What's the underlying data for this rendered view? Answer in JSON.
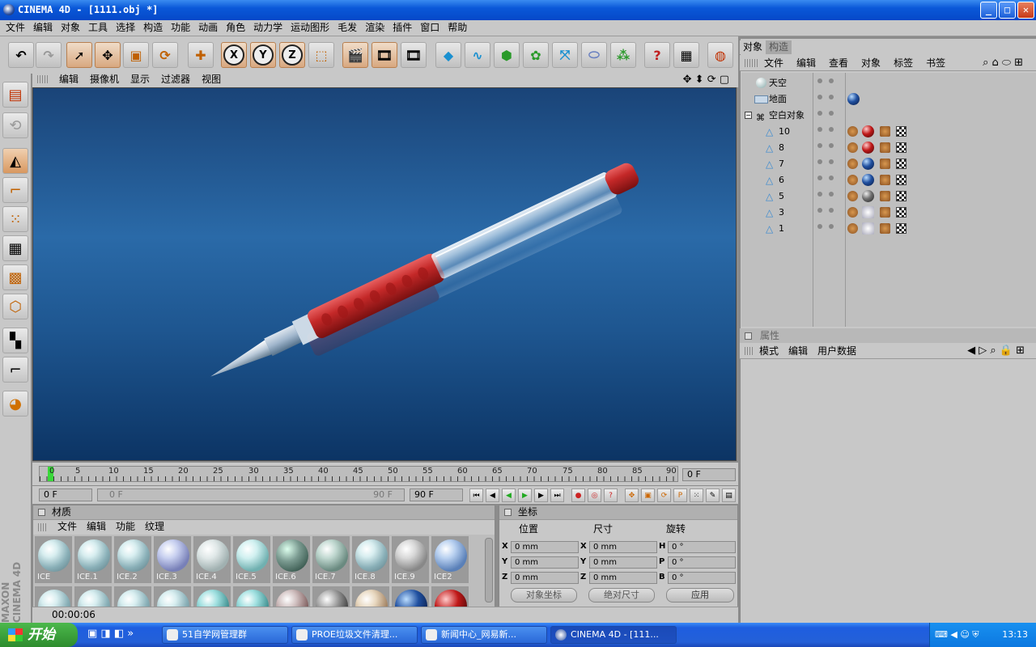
{
  "window": {
    "title": "CINEMA 4D - [1111.obj *]",
    "min": "_",
    "max": "□",
    "close": "✕"
  },
  "menubar": [
    "文件",
    "编辑",
    "对象",
    "工具",
    "选择",
    "构造",
    "功能",
    "动画",
    "角色",
    "动力学",
    "运动图形",
    "毛发",
    "渲染",
    "插件",
    "窗口",
    "帮助"
  ],
  "toolbar": {
    "x": "X",
    "y": "Y",
    "z": "Z"
  },
  "viewport": {
    "menu": [
      "编辑",
      "摄像机",
      "显示",
      "过滤器",
      "视图"
    ]
  },
  "timeline": {
    "ticks": [
      "0",
      "5",
      "10",
      "15",
      "20",
      "25",
      "30",
      "35",
      "40",
      "45",
      "50",
      "55",
      "60",
      "65",
      "70",
      "75",
      "80",
      "85",
      "90"
    ],
    "current_frame": "0 F",
    "start_field": "0 F",
    "range_start": "0 F",
    "range_end": "90 F",
    "end_field": "90 F"
  },
  "materials": {
    "title": "材质",
    "menu": [
      "文件",
      "编辑",
      "功能",
      "纹理"
    ],
    "items": [
      "ICE",
      "ICE.1",
      "ICE.2",
      "ICE.3",
      "ICE.4",
      "ICE.5",
      "ICE.6",
      "ICE.7",
      "ICE.8",
      "ICE.9",
      "ICE2"
    ]
  },
  "coords": {
    "title": "坐标",
    "col_position": "位置",
    "col_size": "尺寸",
    "col_rotation": "旋转",
    "pos": {
      "x_label": "X",
      "y_label": "Y",
      "z_label": "Z",
      "x": "0 mm",
      "y": "0 mm",
      "z": "0 mm"
    },
    "size": {
      "x_label": "X",
      "y_label": "Y",
      "z_label": "Z",
      "x": "0 mm",
      "y": "0 mm",
      "z": "0 mm"
    },
    "rot": {
      "h_label": "H",
      "p_label": "P",
      "b_label": "B",
      "h": "0 °",
      "p": "0 °",
      "b": "0 °"
    },
    "mode1": "对象坐标",
    "mode2": "绝对尺寸",
    "apply": "应用"
  },
  "status": {
    "time": "00:00:06"
  },
  "objects": {
    "tabs": [
      "对象",
      "构造"
    ],
    "menu": [
      "文件",
      "编辑",
      "查看",
      "对象",
      "标签",
      "书签"
    ],
    "tree": [
      {
        "name": "天空",
        "tags": []
      },
      {
        "name": "地面",
        "tags": [
          "blue"
        ]
      },
      {
        "name": "空白对象",
        "tags": []
      },
      {
        "name": "10",
        "tags": [
          "red"
        ]
      },
      {
        "name": "8",
        "tags": [
          "red"
        ]
      },
      {
        "name": "7",
        "tags": [
          "blue"
        ]
      },
      {
        "name": "6",
        "tags": [
          "blue"
        ]
      },
      {
        "name": "5",
        "tags": [
          "grey"
        ]
      },
      {
        "name": "3",
        "tags": [
          "ice"
        ]
      },
      {
        "name": "1",
        "tags": [
          "ice"
        ]
      }
    ]
  },
  "attributes": {
    "title": "属性",
    "menu": [
      "模式",
      "编辑",
      "用户数据"
    ]
  },
  "taskbar": {
    "start": "开始",
    "tasks": [
      "51自学网管理群",
      "PROE垃圾文件清理...",
      "新闻中心_网易新...",
      "CINEMA 4D - [111..."
    ],
    "clock": "13:13"
  },
  "colors": {
    "accent": "#0a58d8",
    "viewport_top": "#1a4478",
    "pen_red": "#b82828"
  }
}
